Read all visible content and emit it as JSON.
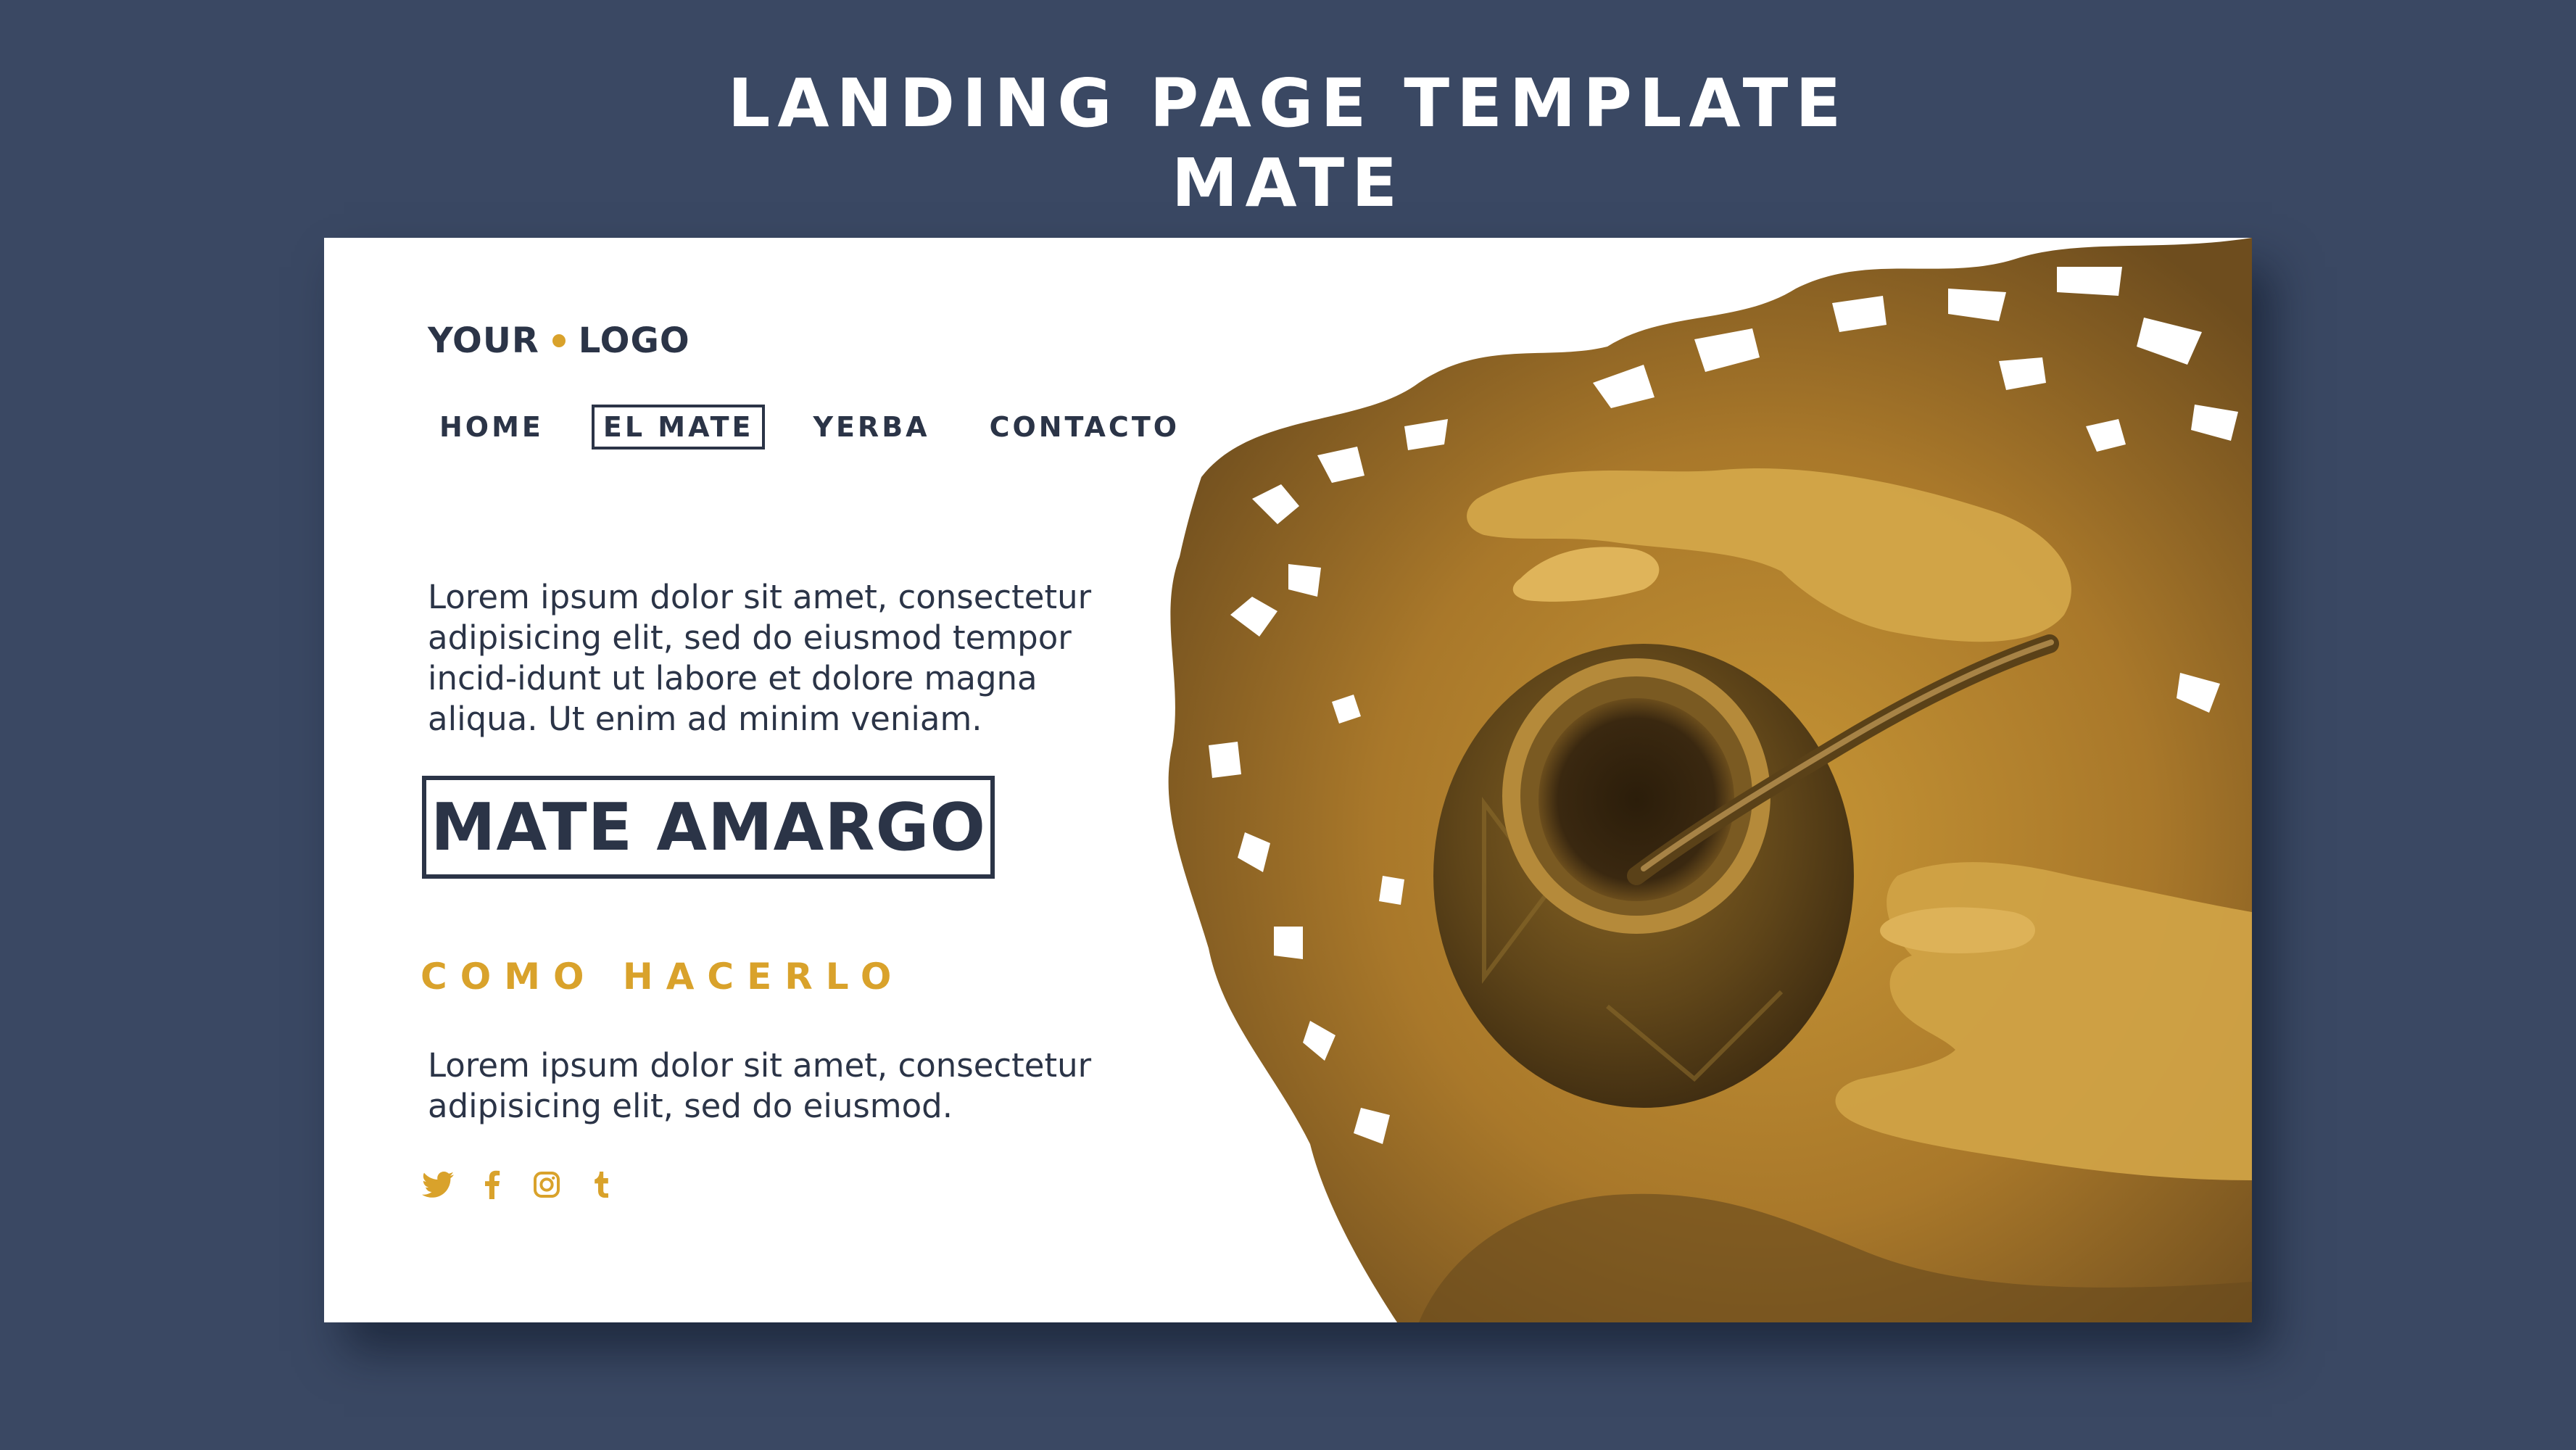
{
  "header": {
    "line1": "LANDING PAGE TEMPLATE",
    "line2": "MATE"
  },
  "logo": {
    "part1": "YOUR",
    "part2": "LOGO"
  },
  "nav": {
    "items": [
      "HOME",
      "EL MATE",
      "YERBA",
      "CONTACTO"
    ],
    "active": "EL MATE"
  },
  "intro_text": "Lorem ipsum dolor sit amet, consectetur adipisicing elit, sed do eiusmod tempor incid-idunt ut labore et dolore magna aliqua. Ut enim ad minim veniam.",
  "headline": "MATE AMARGO",
  "subheading": "COMO HACERLO",
  "how_text": "Lorem ipsum dolor sit amet, consectetur adipisicing elit, sed do eiusmod.",
  "social": {
    "icons": [
      "twitter-icon",
      "facebook-icon",
      "instagram-icon",
      "tumblr-icon"
    ]
  },
  "colors": {
    "background": "#3a4863",
    "card": "#ffffff",
    "text_dark": "#2b3447",
    "accent": "#d9a22b"
  }
}
